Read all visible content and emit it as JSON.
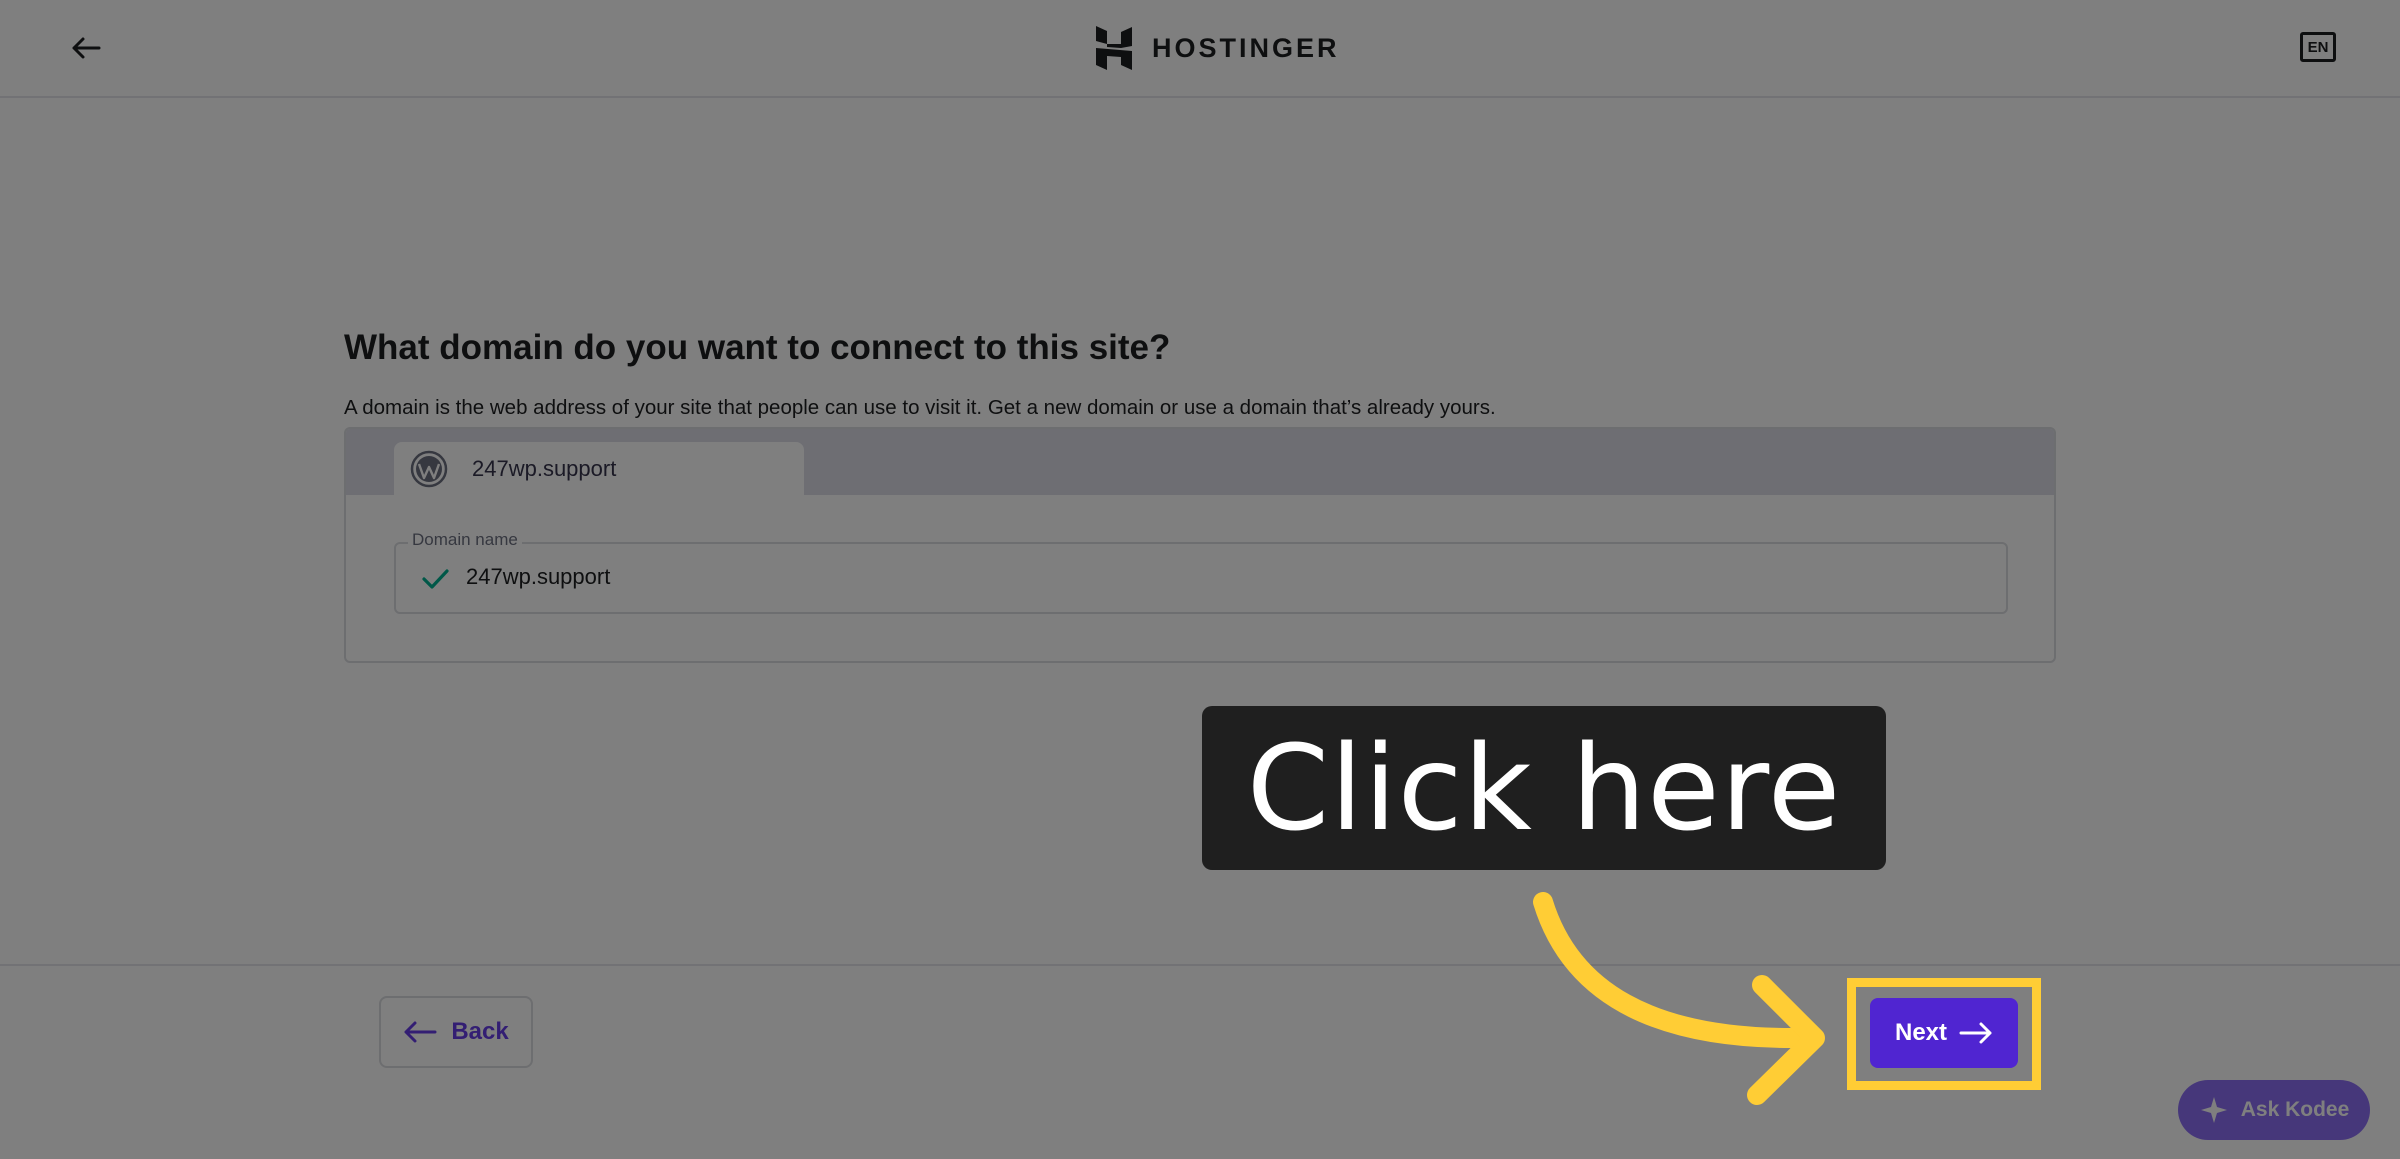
{
  "header": {
    "brand": "HOSTINGER",
    "language": "EN"
  },
  "main": {
    "question": "What domain do you want to connect to this site?",
    "subtitle": "A domain is the web address of your site that people can use to visit it. Get a new domain or use a domain that’s already yours.",
    "tab_label": "247wp.support",
    "field_legend": "Domain name",
    "field_value": "247wp.support"
  },
  "footer": {
    "back_label": "Back",
    "next_label": "Next"
  },
  "assistant": {
    "label": "Ask Kodee"
  },
  "annotation": {
    "callout_text": "Click here"
  },
  "colors": {
    "brand_purple": "#673de6",
    "highlight_yellow": "#ffcd35",
    "success_green": "#00b090"
  }
}
